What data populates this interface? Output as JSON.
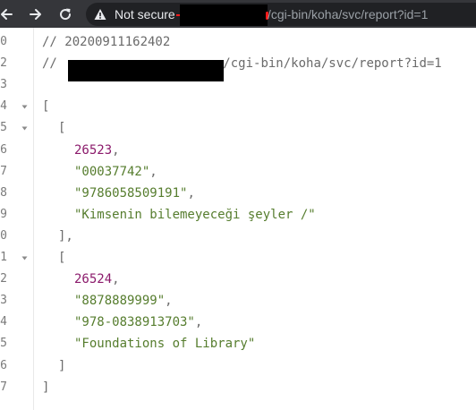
{
  "browser": {
    "security_label": "Not secure",
    "url_path": "/cgi-bin/koha/svc/report?id=1",
    "icons": [
      "back-arrow-icon",
      "forward-arrow-icon",
      "reload-icon",
      "warning-icon"
    ]
  },
  "code_lines": [
    {
      "n": "0",
      "text": "// 20200911162402",
      "kind": "comment"
    },
    {
      "n": "2",
      "text": "/cgi-bin/koha/svc/report?id=1",
      "kind": "comment"
    },
    {
      "n": "3",
      "text": "",
      "kind": "blank"
    },
    {
      "n": "4",
      "text": "[",
      "kind": "punc"
    },
    {
      "n": "5",
      "text": "[",
      "kind": "punc"
    },
    {
      "n": "6",
      "text": "26523",
      "kind": "num",
      "suffix": ","
    },
    {
      "n": "7",
      "text": "\"00037742\"",
      "kind": "str",
      "suffix": ","
    },
    {
      "n": "8",
      "text": "\"9786058509191\"",
      "kind": "str",
      "suffix": ","
    },
    {
      "n": "9",
      "text": "\"Kimsenin bilemeyeceği şeyler /\"",
      "kind": "str",
      "suffix": ""
    },
    {
      "n": "10",
      "text": "],",
      "kind": "punc"
    },
    {
      "n": "11",
      "text": "[",
      "kind": "punc"
    },
    {
      "n": "12",
      "text": "26524",
      "kind": "num",
      "suffix": ","
    },
    {
      "n": "13",
      "text": "\"8878889999\"",
      "kind": "str",
      "suffix": ","
    },
    {
      "n": "14",
      "text": "\"978-0838913703\"",
      "kind": "str",
      "suffix": ","
    },
    {
      "n": "15",
      "text": "\"Foundations of Library\"",
      "kind": "str",
      "suffix": ""
    },
    {
      "n": "16",
      "text": "]",
      "kind": "punc"
    },
    {
      "n": "17",
      "text": "]",
      "kind": "punc"
    }
  ],
  "comment_prefix_line2": "// "
}
